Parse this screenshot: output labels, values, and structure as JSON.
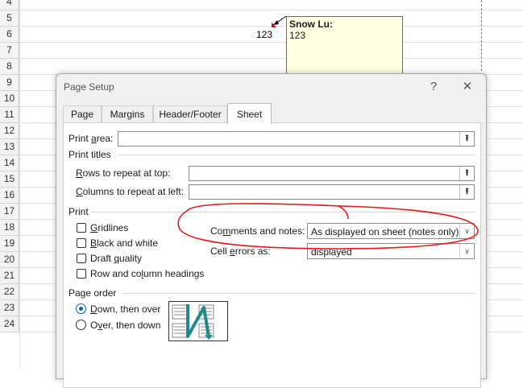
{
  "spreadsheet": {
    "row_numbers": [
      "4",
      "5",
      "6",
      "7",
      "8",
      "9",
      "10",
      "11",
      "12",
      "13",
      "14",
      "15",
      "16",
      "17",
      "18",
      "19",
      "20",
      "21",
      "22",
      "23",
      "24"
    ],
    "cell_value": "123",
    "note": {
      "author": "Snow Lu:",
      "text": "123"
    }
  },
  "dialog": {
    "title": "Page Setup",
    "help_label": "?",
    "close_label": "✕",
    "tabs": [
      {
        "label": "Page"
      },
      {
        "label": "Margins"
      },
      {
        "label": "Header/Footer"
      },
      {
        "label": "Sheet",
        "active": true
      }
    ],
    "print_area": {
      "label_pre": "Print ",
      "label_u": "a",
      "label_post": "rea:",
      "value": ""
    },
    "print_titles": {
      "heading": "Print titles",
      "rows": {
        "label_u": "R",
        "label_post": "ows to repeat at top:",
        "value": ""
      },
      "columns": {
        "label_u": "C",
        "label_post": "olumns to repeat at left:",
        "value": ""
      }
    },
    "print": {
      "heading": "Print",
      "options": [
        {
          "pre": "",
          "u": "G",
          "post": "ridlines",
          "checked": false
        },
        {
          "pre": "",
          "u": "B",
          "post": "lack and white",
          "checked": false
        },
        {
          "pre": "Draft ",
          "u": "q",
          "post": "uality",
          "checked": false
        },
        {
          "pre": "Row and co",
          "u": "l",
          "post": "umn headings",
          "checked": false
        }
      ],
      "comments_label_pre": "Co",
      "comments_label_u": "m",
      "comments_label_post": "ments and notes:",
      "comments_value": "As displayed on sheet (notes only)",
      "errors_label_pre": "Cell ",
      "errors_label_u": "e",
      "errors_label_post": "rrors as:",
      "errors_value": "displayed"
    },
    "page_order": {
      "heading": "Page order",
      "options": [
        {
          "pre": "",
          "u": "D",
          "post": "own, then over",
          "selected": true
        },
        {
          "pre": "O",
          "u": "v",
          "post": "er, then down",
          "selected": false
        }
      ]
    }
  },
  "colors": {
    "accent": "#005fb8",
    "annotation": "#e8191a",
    "note_bg": "#ffffe1",
    "arrow_teal": "#1f8a8a"
  }
}
